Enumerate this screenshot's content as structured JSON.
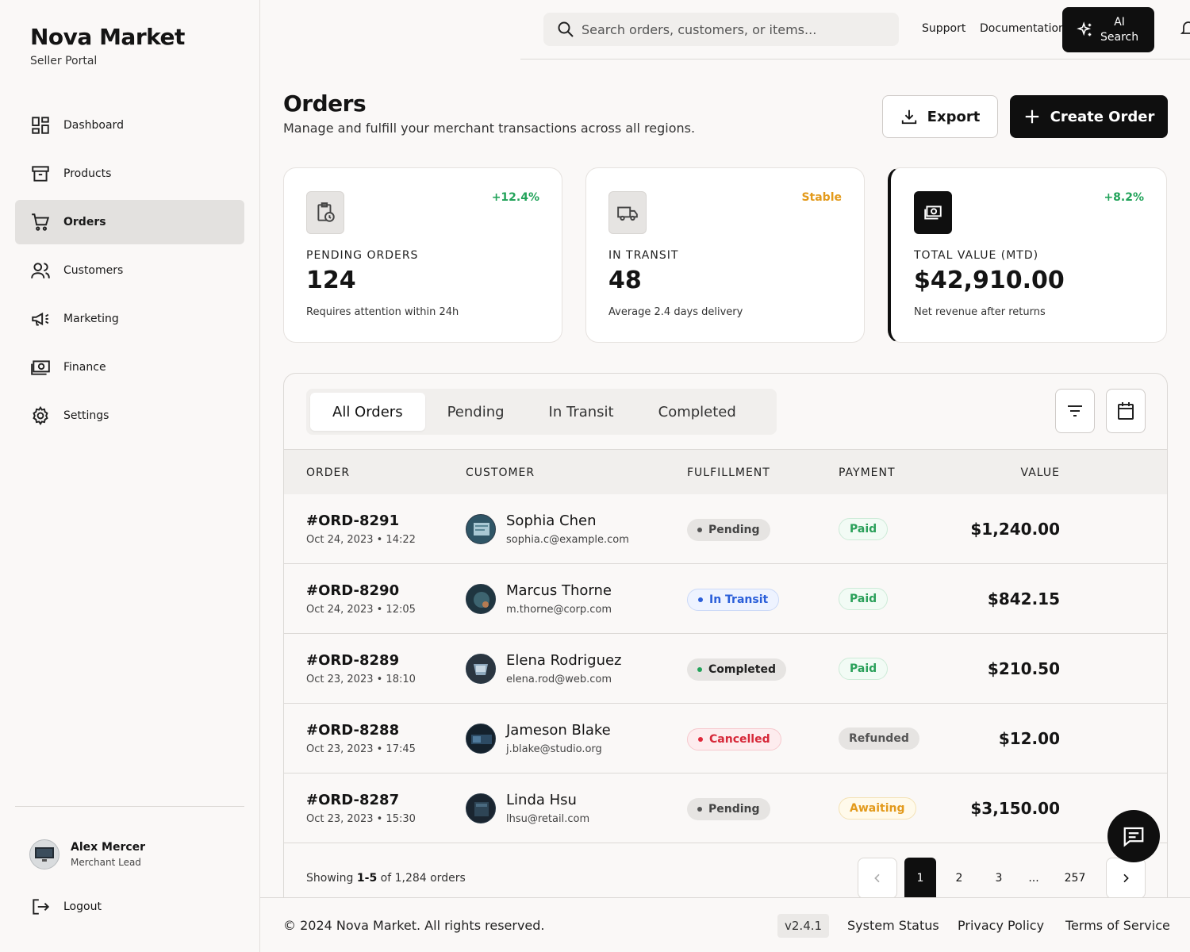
{
  "brand": {
    "title": "Nova Market",
    "subtitle": "Seller Portal"
  },
  "sidebar": {
    "items": [
      {
        "label": "Dashboard",
        "icon": "dashboard-icon",
        "active": false
      },
      {
        "label": "Products",
        "icon": "archive-box-icon",
        "active": false
      },
      {
        "label": "Orders",
        "icon": "cart-icon",
        "active": true
      },
      {
        "label": "Customers",
        "icon": "users-icon",
        "active": false
      },
      {
        "label": "Marketing",
        "icon": "megaphone-icon",
        "active": false
      },
      {
        "label": "Finance",
        "icon": "cash-icon",
        "active": false
      },
      {
        "label": "Settings",
        "icon": "gear-icon",
        "active": false
      }
    ],
    "user": {
      "name": "Alex Mercer",
      "role": "Merchant Lead"
    },
    "logout_label": "Logout"
  },
  "topbar": {
    "search_placeholder": "Search orders, customers, or items...",
    "support_label": "Support",
    "documentation_label": "Documentation",
    "ai_search_line1": "AI",
    "ai_search_line2": "Search"
  },
  "header": {
    "title": "Orders",
    "subtitle": "Manage and fulfill your merchant transactions across all regions.",
    "export_label": "Export",
    "create_label": "Create Order"
  },
  "stats": [
    {
      "label": "PENDING ORDERS",
      "value": "124",
      "desc": "Requires attention within 24h",
      "trend": "+12.4%",
      "trend_color": "#22a35a"
    },
    {
      "label": "IN TRANSIT",
      "value": "48",
      "desc": "Average 2.4 days delivery",
      "trend": "Stable",
      "trend_color": "#e39a1b"
    },
    {
      "label": "TOTAL VALUE (MTD)",
      "value": "$42,910.00",
      "desc": "Net revenue after returns",
      "trend": "+8.2%",
      "trend_color": "#22a35a"
    }
  ],
  "tabs": [
    "All Orders",
    "Pending",
    "In Transit",
    "Completed"
  ],
  "table": {
    "headers": {
      "order": "ORDER",
      "customer": "CUSTOMER",
      "fulfillment": "FULFILLMENT",
      "payment": "PAYMENT",
      "value": "VALUE"
    },
    "rows": [
      {
        "id": "#ORD-8291",
        "date": "Oct 24, 2023 • 14:22",
        "name": "Sophia Chen",
        "email": "sophia.c@example.com",
        "fulfillment": "Pending",
        "payment": "Paid",
        "value": "$1,240.00"
      },
      {
        "id": "#ORD-8290",
        "date": "Oct 24, 2023 • 12:05",
        "name": "Marcus Thorne",
        "email": "m.thorne@corp.com",
        "fulfillment": "In Transit",
        "payment": "Paid",
        "value": "$842.15"
      },
      {
        "id": "#ORD-8289",
        "date": "Oct 23, 2023 • 18:10",
        "name": "Elena Rodriguez",
        "email": "elena.rod@web.com",
        "fulfillment": "Completed",
        "payment": "Paid",
        "value": "$210.50"
      },
      {
        "id": "#ORD-8288",
        "date": "Oct 23, 2023 • 17:45",
        "name": "Jameson Blake",
        "email": "j.blake@studio.org",
        "fulfillment": "Cancelled",
        "payment": "Refunded",
        "value": "$12.00"
      },
      {
        "id": "#ORD-8287",
        "date": "Oct 23, 2023 • 15:30",
        "name": "Linda Hsu",
        "email": "lhsu@retail.com",
        "fulfillment": "Pending",
        "payment": "Awaiting",
        "value": "$3,150.00"
      }
    ]
  },
  "pagination": {
    "showing_prefix": "Showing",
    "showing_range": "1-5",
    "showing_suffix": "of 1,284 orders",
    "pages": [
      "1",
      "2",
      "3",
      "...",
      "257"
    ],
    "current": "1"
  },
  "footer": {
    "copyright": "© 2024 Nova Market. All rights reserved.",
    "version": "v2.4.1",
    "links": [
      "System Status",
      "Privacy Policy",
      "Terms of Service"
    ]
  },
  "colors": {
    "accent": "#0f0f0f",
    "success": "#22a35a",
    "info": "#2b5fd9",
    "danger": "#e0283b",
    "warning": "#e39a1b"
  }
}
